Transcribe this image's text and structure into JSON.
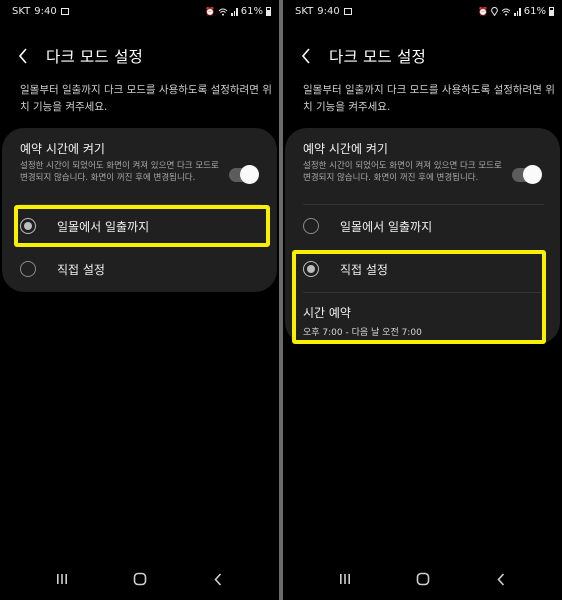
{
  "status_bar": {
    "carrier": "SKT",
    "time": "9:40",
    "battery": "61%"
  },
  "header": {
    "back_icon": "chevron-left-icon",
    "title": "다크 모드 설정"
  },
  "description": "일몰부터 일출까지 다크 모드를 사용하도록 설정하려면 위치 기능을 켜주세요.",
  "schedule_toggle": {
    "title": "예약 시간에 켜기",
    "subtitle": "설정한 시간이 되었어도 화면이 켜져 있으면 다크 모드로 변경되지 않습니다. 화면이 꺼진 후에 변경됩니다.",
    "enabled": true
  },
  "options": {
    "sunset_to_sunrise": "일몰에서 일출까지",
    "custom": "직접 설정"
  },
  "left_screen": {
    "selected_option": "sunset_to_sunrise"
  },
  "right_screen": {
    "selected_option": "custom",
    "schedule": {
      "title": "시간 예약",
      "value": "오후 7:00 - 다음 날 오전 7:00"
    }
  },
  "highlight_color": "#f8f000",
  "navigation": {
    "recent_icon": "recent-apps-icon",
    "home_icon": "home-icon",
    "back_icon": "back-icon"
  }
}
